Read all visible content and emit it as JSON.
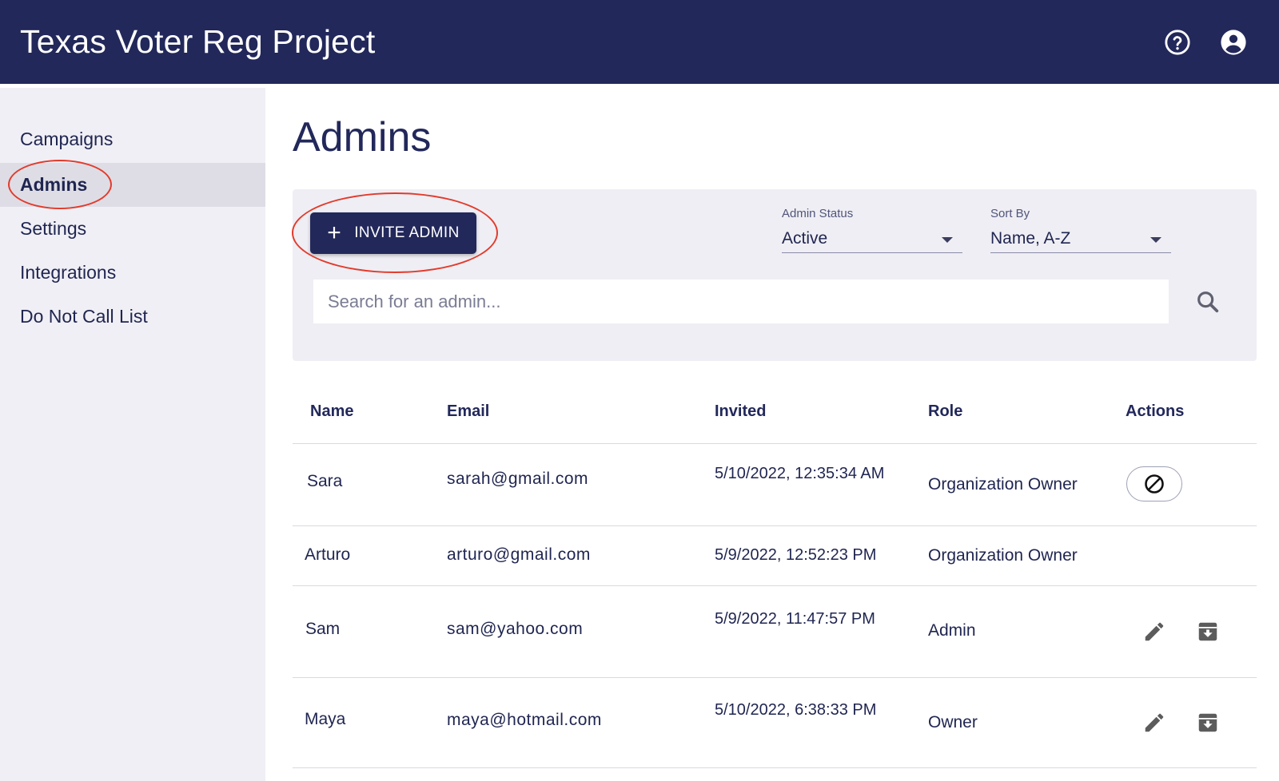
{
  "header": {
    "title": "Texas Voter Reg Project",
    "help_icon": "help-circle-icon",
    "account_icon": "account-circle-icon"
  },
  "sidebar": {
    "items": [
      {
        "label": "Campaigns",
        "active": false
      },
      {
        "label": "Admins",
        "active": true
      },
      {
        "label": "Settings",
        "active": false
      },
      {
        "label": "Integrations",
        "active": false
      },
      {
        "label": "Do Not Call List",
        "active": false
      }
    ]
  },
  "main": {
    "title": "Admins",
    "invite_button": {
      "label": "INVITE ADMIN",
      "icon": "plus"
    },
    "admin_status": {
      "label": "Admin Status",
      "value": "Active"
    },
    "sort_by": {
      "label": "Sort By",
      "value": "Name, A-Z"
    },
    "search": {
      "placeholder": "Search for an admin..."
    }
  },
  "table": {
    "columns": [
      "Name",
      "Email",
      "Invited",
      "Role",
      "Actions"
    ],
    "rows": [
      {
        "name": "Sara",
        "email": "sarah@gmail.com",
        "invited": "5/10/2022, 12:35:34 AM",
        "role": "Organization Owner",
        "actions": [
          "block"
        ]
      },
      {
        "name": "Arturo",
        "email": "arturo@gmail.com",
        "invited": "5/9/2022, 12:52:23 PM",
        "role": "Organization Owner",
        "actions": []
      },
      {
        "name": "Sam",
        "email": "sam@yahoo.com",
        "invited": "5/9/2022, 11:47:57 PM",
        "role": "Admin",
        "actions": [
          "edit",
          "archive"
        ]
      },
      {
        "name": "Maya",
        "email": "maya@hotmail.com",
        "invited": "5/10/2022, 6:38:33 PM",
        "role": "Owner",
        "actions": [
          "edit",
          "archive"
        ]
      }
    ]
  },
  "colors": {
    "header_bg": "#22285a",
    "sidebar_bg": "#f0eff5",
    "annotation_circle": "#e23b2c"
  }
}
